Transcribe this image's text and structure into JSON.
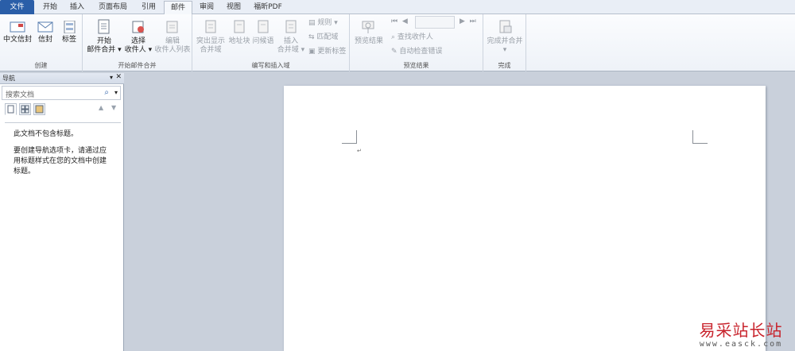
{
  "ribbon_tabs": [
    "文件",
    "开始",
    "插入",
    "页面布局",
    "引用",
    "邮件",
    "审阅",
    "视图",
    "福昕PDF"
  ],
  "groups": {
    "create": {
      "label": "创建",
      "chinese_envelope": "中文信封",
      "envelope": "信封",
      "labels": "标签"
    },
    "start_merge": {
      "label": "开始邮件合并",
      "start_line1": "开始",
      "start_line2": "邮件合并",
      "select_line1": "选择",
      "select_line2": "收件人",
      "edit_line1": "编辑",
      "edit_line2": "收件人列表"
    },
    "write_insert": {
      "label": "编写和插入域",
      "highlight_line1": "突出显示",
      "highlight_line2": "合并域",
      "address_block": "地址块",
      "greeting": "问候语",
      "insert_line1": "插入",
      "insert_line2": "合并域",
      "rules": "规则",
      "match_fields": "匹配域",
      "update_labels": "更新标签"
    },
    "preview": {
      "label": "预览结果",
      "preview_results": "预览结果",
      "find_recipient": "查找收件人",
      "auto_check": "自动检查错误"
    },
    "finish": {
      "label": "完成",
      "finish_merge": "完成并合并"
    }
  },
  "nav": {
    "title": "导航",
    "search_placeholder": "搜索文档",
    "msg1": "此文档不包含标题。",
    "msg2": "要创建导航选项卡，请通过应用标题样式在您的文档中创建标题。"
  },
  "watermark": {
    "site": "易采站长站",
    "url": "www.easck.com"
  }
}
